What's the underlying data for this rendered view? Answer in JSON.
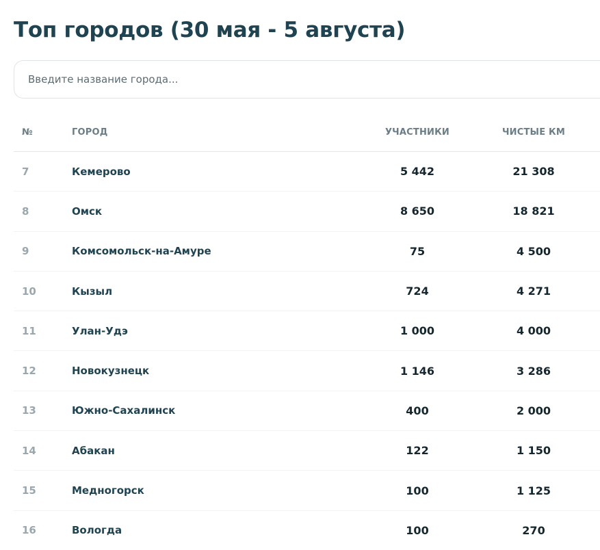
{
  "page": {
    "title": "Топ городов (30 мая - 5 августа)"
  },
  "search": {
    "placeholder": "Введите название города..."
  },
  "table": {
    "headers": {
      "num": "№",
      "city": "ГОРОД",
      "participants": "УЧАСТНИКИ",
      "km": "ЧИСТЫЕ КМ"
    },
    "rows": [
      {
        "num": "7",
        "city": "Кемерово",
        "participants": "5 442",
        "km": "21 308"
      },
      {
        "num": "8",
        "city": "Омск",
        "participants": "8 650",
        "km": "18 821"
      },
      {
        "num": "9",
        "city": "Комсомольск-на-Амуре",
        "participants": "75",
        "km": "4 500"
      },
      {
        "num": "10",
        "city": "Кызыл",
        "participants": "724",
        "km": "4 271"
      },
      {
        "num": "11",
        "city": "Улан-Удэ",
        "participants": "1 000",
        "km": "4 000"
      },
      {
        "num": "12",
        "city": "Новокузнецк",
        "participants": "1 146",
        "km": "3 286"
      },
      {
        "num": "13",
        "city": "Южно-Сахалинск",
        "participants": "400",
        "km": "2 000"
      },
      {
        "num": "14",
        "city": "Абакан",
        "participants": "122",
        "km": "1 150"
      },
      {
        "num": "15",
        "city": "Медногорск",
        "participants": "100",
        "km": "1 125"
      },
      {
        "num": "16",
        "city": "Вологда",
        "participants": "100",
        "km": "270"
      }
    ]
  },
  "colors": {
    "title": "#1f4351",
    "header_text": "#6b7d86",
    "rank_text": "#9aa7ad",
    "value_text": "#14262e"
  }
}
